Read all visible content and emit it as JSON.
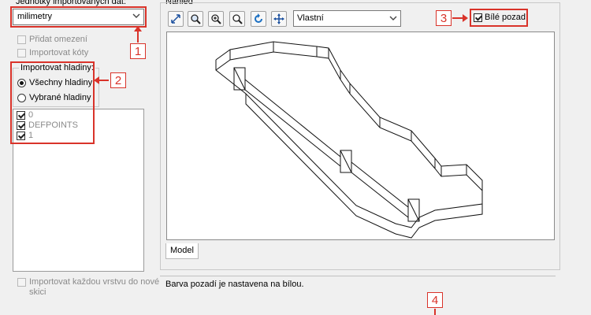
{
  "left": {
    "units_label": "Jednotky importovaných dat:",
    "units_value": "milimetry",
    "add_constraints": "Přidat omezení",
    "import_dims": "Importovat kóty",
    "import_layers_label": "Importovat hladiny:",
    "all_layers": "Všechny hladiny",
    "selected_layers": "Vybrané hladiny",
    "layers": [
      "0",
      "DEFPOINTS",
      "1"
    ],
    "each_layer_line1": "Importovat každou vrstvu do nové",
    "each_layer_line2": "skici"
  },
  "preview": {
    "label": "Náhled",
    "view_value": "Vlastní",
    "white_bg": "Bílé pozadí",
    "tab_model": "Model",
    "status": "Barva pozadí je nastavena na bílou."
  },
  "markers": [
    "1",
    "2",
    "3",
    "4"
  ],
  "colors": {
    "annotation_red": "#d9332a"
  }
}
